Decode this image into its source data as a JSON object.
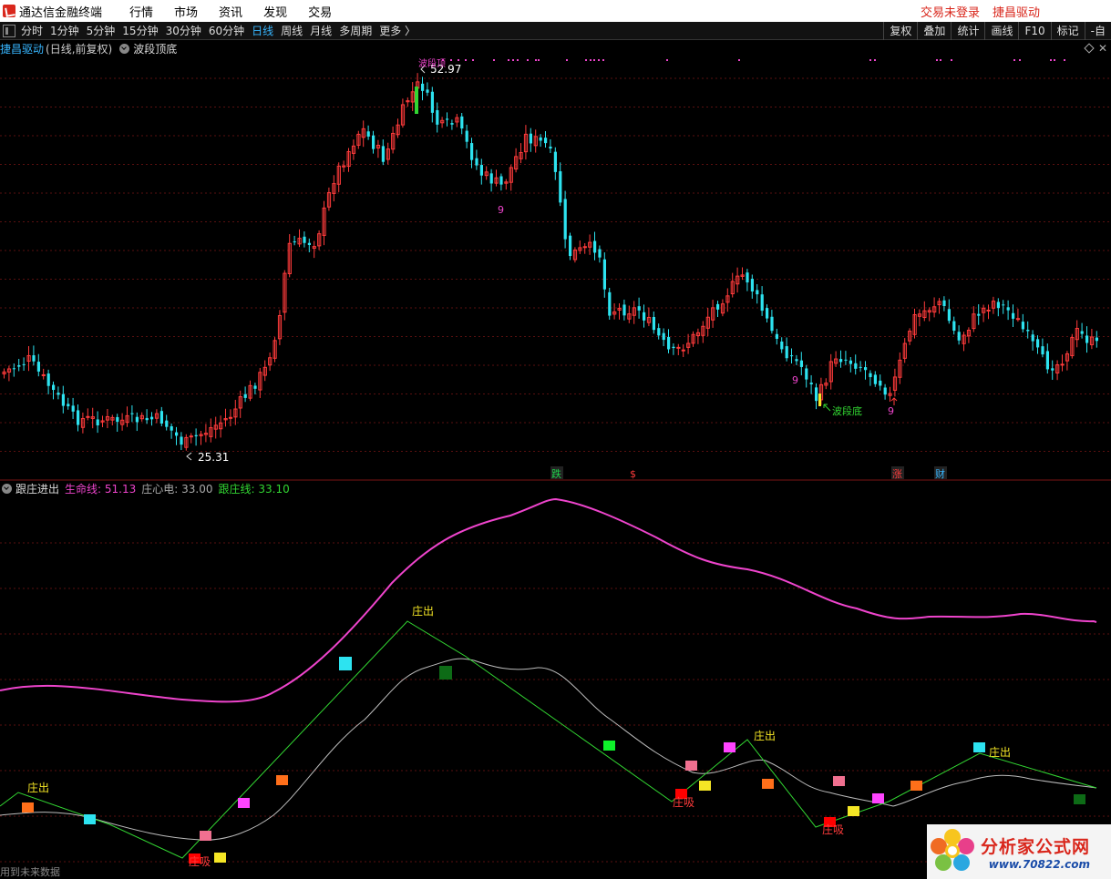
{
  "titlebar": {
    "app_title": "通达信金融终端",
    "menu": [
      "行情",
      "市场",
      "资讯",
      "发现",
      "交易"
    ],
    "right_links": [
      "交易未登录",
      "捷昌驱动"
    ]
  },
  "toolbar": {
    "periods": [
      "分时",
      "1分钟",
      "5分钟",
      "15分钟",
      "30分钟",
      "60分钟",
      "日线",
      "周线",
      "月线",
      "多周期",
      "更多 〉"
    ],
    "active_period": "日线",
    "right_buttons": [
      "复权",
      "叠加",
      "统计",
      "画线",
      "F10",
      "标记",
      "-自"
    ]
  },
  "main_chart": {
    "stock_name": "捷昌驱动",
    "mode": "(日线,前复权)",
    "indicator": "波段顶底",
    "high_label": "52.97",
    "low_label": "25.31",
    "top_pink_label": "波段顶",
    "wave_bottom_label": "波段底",
    "nine_labels": [
      "9",
      "9",
      "9"
    ],
    "event_markers": [
      {
        "text": "跌",
        "color": "#1fd34a"
      },
      {
        "text": "$",
        "color": "#ff3b3b"
      },
      {
        "text": "涨",
        "color": "#ff3b3b"
      },
      {
        "text": "财",
        "color": "#37b6ff"
      }
    ],
    "colors": {
      "up": "#ff3b3b",
      "down": "#2de3f0",
      "grid": "#5a1010"
    }
  },
  "sub_chart": {
    "name": "跟庄进出",
    "legend": [
      {
        "label": "生命线:",
        "value": "51.13",
        "color": "#ee44cc"
      },
      {
        "label": "庄心电:",
        "value": "33.00",
        "color": "#aaaaaa"
      },
      {
        "label": "跟庄线:",
        "value": "33.10",
        "color": "#32d632"
      }
    ],
    "zhuang_chu": "庄出",
    "zhuang_xi": "庄吸",
    "colors": {
      "life": "#ee44cc",
      "heart": "#bbbbbb",
      "follow": "#32d632"
    }
  },
  "bottom_note": "用到未来数据",
  "site_badge": {
    "cn": "分析家公式网",
    "url": "www.70822.com"
  },
  "chart_data": {
    "type": "candlestick",
    "title": "捷昌驱动 (日线,前复权)",
    "high": 52.97,
    "low": 25.31,
    "indicator_values": {
      "生命线": 51.13,
      "庄心电": 33.0,
      "跟庄线": 33.1
    }
  }
}
